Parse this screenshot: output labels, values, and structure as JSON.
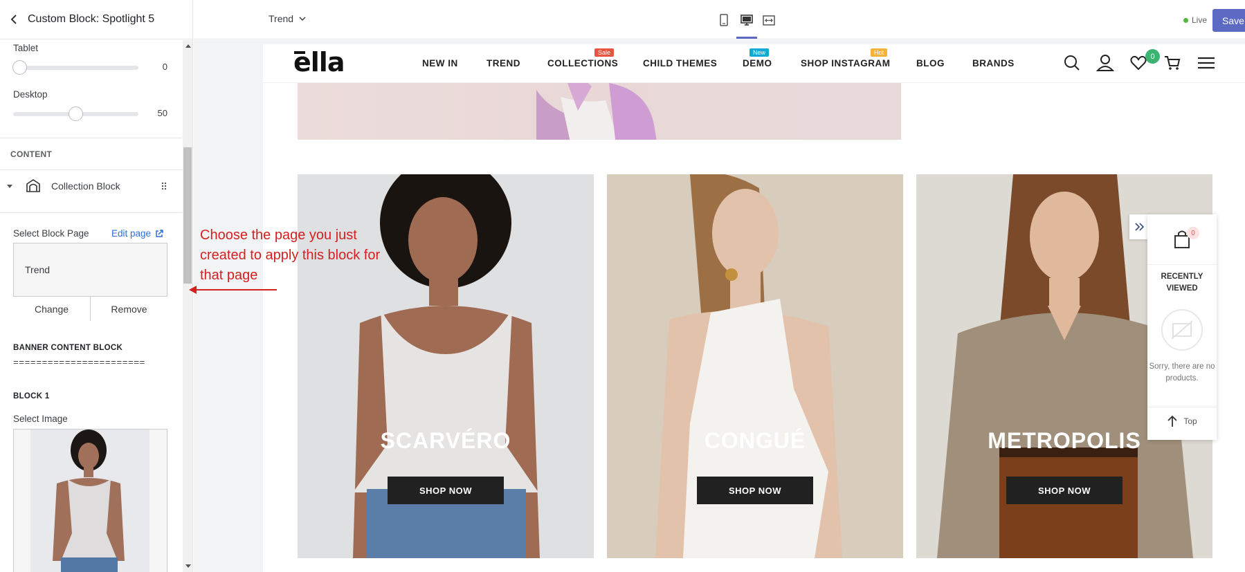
{
  "sidebar": {
    "title": "Custom Block: Spotlight 5",
    "tablet": {
      "label": "Tablet",
      "value": "0",
      "level": 0
    },
    "desktop": {
      "label": "Desktop",
      "value": "50",
      "level": 0.5
    },
    "content_section": "CONTENT",
    "collection_block": "Collection Block",
    "select_block_page": "Select Block Page",
    "edit_page": "Edit page",
    "selected_page": "Trend",
    "change": "Change",
    "remove": "Remove",
    "banner_content_block": "BANNER CONTENT BLOCK",
    "separator": "=======================",
    "block1": "BLOCK 1",
    "select_image": "Select Image"
  },
  "topbar": {
    "page": "Trend",
    "live": "Live",
    "save": "Save"
  },
  "store": {
    "logo": "ella",
    "nav": [
      {
        "label": "NEW IN"
      },
      {
        "label": "TREND"
      },
      {
        "label": "COLLECTIONS",
        "badge": "Sale",
        "badge_color": "#e8553e"
      },
      {
        "label": "CHILD THEMES"
      },
      {
        "label": "DEMO",
        "badge": "New",
        "badge_color": "#14a9d3"
      },
      {
        "label": "SHOP INSTAGRAM",
        "badge": "Hot",
        "badge_color": "#f4b33b"
      },
      {
        "label": "BLOG"
      },
      {
        "label": "BRANDS"
      }
    ],
    "cart_count": "0",
    "cards": [
      {
        "title": "SCARVÉRO",
        "button": "SHOP NOW"
      },
      {
        "title": "CONGUÉ",
        "button": "SHOP NOW"
      },
      {
        "title": "METROPOLIS",
        "button": "SHOP NOW"
      }
    ]
  },
  "recently_viewed": {
    "count": "0",
    "title": "RECENTLY VIEWED",
    "empty": "Sorry, there are no products.",
    "top": "Top"
  },
  "annotation": "Choose the page you just created to apply this block for that page",
  "colors": {
    "accent": "#5c6ac4",
    "annotation": "#d42020",
    "cart_badge": "#3cb371"
  }
}
